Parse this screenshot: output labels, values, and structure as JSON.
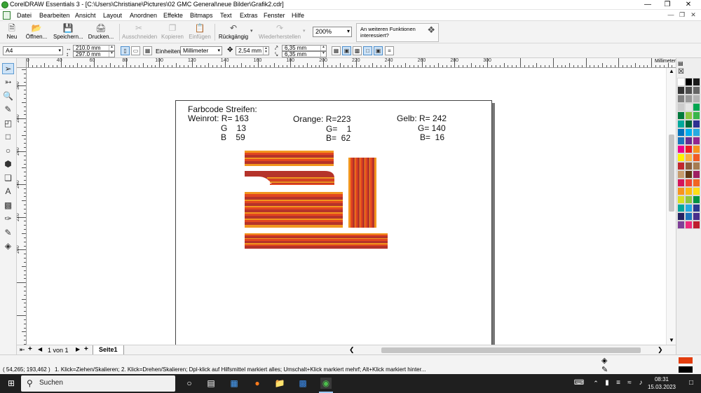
{
  "window": {
    "title": "CorelDRAW Essentials 3 - [C:\\Users\\Christiane\\Pictures\\02 GMC General\\neue Bilder\\Grafik2.cdr]"
  },
  "menu": [
    "Datei",
    "Bearbeiten",
    "Ansicht",
    "Layout",
    "Anordnen",
    "Effekte",
    "Bitmaps",
    "Text",
    "Extras",
    "Fenster",
    "Hilfe"
  ],
  "toolbar": {
    "new_label": "Neu",
    "open_label": "Öffnen...",
    "save_label": "Speichern...",
    "print_label": "Drucken...",
    "cut_label": "Ausschneiden",
    "copy_label": "Kopieren",
    "paste_label": "Einfügen",
    "undo_label": "Rückgängig",
    "redo_label": "Wiederherstellen",
    "zoom": "200%",
    "hint_text": "An weiteren Funktionen interessiert?"
  },
  "properties": {
    "page_size": "A4",
    "width": "210.0 mm",
    "height": "297.0 mm",
    "units_label": "Einheiten:",
    "units": "Millimeter",
    "nudge": "2,54 mm",
    "dup_x": "6,35 mm",
    "dup_y": "6,35 mm"
  },
  "rulers": {
    "unit": "Millimeter",
    "top_labels": [
      "20",
      "40",
      "60",
      "80",
      "100",
      "120",
      "140",
      "160",
      "180",
      "200",
      "220",
      "240",
      "260",
      "280",
      "300"
    ],
    "left_labels": [
      "300",
      "280",
      "260",
      "240",
      "220",
      "200"
    ]
  },
  "canvas": {
    "heading": "Farbcode Streifen:",
    "weinrot": {
      "line1": "Weinrot: R= 163",
      "line2": "G    13",
      "line3": "B    59"
    },
    "orange": {
      "line1": "Orange: R=223",
      "line2": "G=    1",
      "line3": "B=  62"
    },
    "gelb": {
      "line1": "Gelb: R= 242",
      "line2": "G= 140",
      "line3": "B=  16"
    },
    "colors": {
      "weinrot": "#B5332A",
      "orange": "#E2461F",
      "gelb": "#F2961E",
      "lightorange": "#F4A33A"
    }
  },
  "pages": {
    "counter": "1 von 1",
    "tab": "Seite1"
  },
  "status": {
    "coords": "( 54,265; 193,462 )",
    "hint": "1. Klick=Ziehen/Skalieren; 2. Klick=Drehen/Skalieren; Dpl-klick auf Hilfsmittel markiert alles; Umschalt+Klick markiert mehrf; Alt+Klick markiert hinter..."
  },
  "fill_color": "#E23D0E",
  "outline_color": "#000000",
  "taskbar": {
    "search": "Suchen",
    "time": "08:31",
    "date": "15.03.2023"
  },
  "palette": [
    "#ffffff",
    "#000000",
    "#1a1a1a",
    "#333333",
    "#4d4d4d",
    "#666666",
    "#808080",
    "#999999",
    "#b3b3b3",
    "#cccccc",
    "#e6e6e6",
    "#00a651",
    "#007a3d",
    "#8dc63f",
    "#39b54a",
    "#00a99d",
    "#006837",
    "#2e3192",
    "#0072bc",
    "#00aeef",
    "#27aae1",
    "#1b75bc",
    "#662d91",
    "#92278f",
    "#ec008c",
    "#ed1c24",
    "#f7941d",
    "#fff200",
    "#fbb040",
    "#f15a24",
    "#c1272d",
    "#8b5e3c",
    "#a67c52",
    "#c69c6d",
    "#603913",
    "#9e1f63",
    "#d4145a",
    "#ef4136",
    "#f26522",
    "#f7941e",
    "#fdb913",
    "#ffde17",
    "#d7df23",
    "#8cc63f",
    "#009444",
    "#00a79d",
    "#25aae1",
    "#2b3990",
    "#262262",
    "#1c75bc",
    "#4a2e8c",
    "#7f3f98",
    "#ee2a7b",
    "#be1e2d"
  ]
}
